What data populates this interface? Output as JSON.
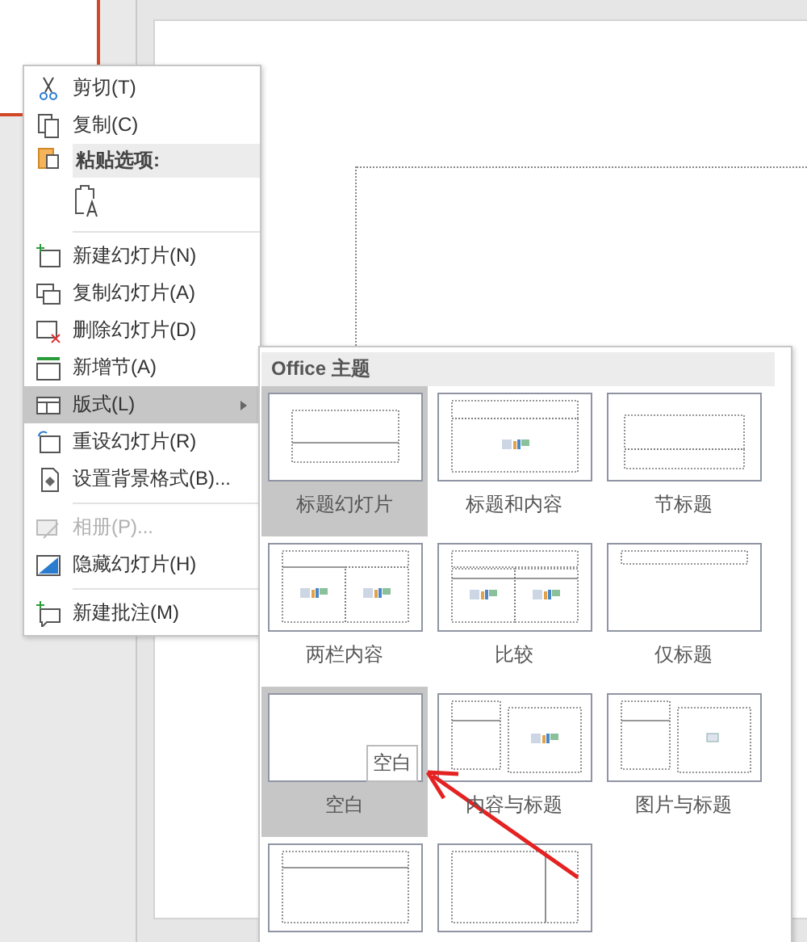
{
  "context_menu": {
    "items": [
      {
        "kind": "command",
        "label": "剪切(T)",
        "disabled": false
      },
      {
        "kind": "command",
        "label": "复制(C)",
        "disabled": false
      },
      {
        "kind": "header",
        "label": "粘贴选项:"
      },
      {
        "kind": "paste"
      },
      {
        "kind": "separator"
      },
      {
        "kind": "command",
        "label": "新建幻灯片(N)",
        "disabled": false
      },
      {
        "kind": "command",
        "label": "复制幻灯片(A)",
        "disabled": false
      },
      {
        "kind": "command",
        "label": "删除幻灯片(D)",
        "disabled": false
      },
      {
        "kind": "command",
        "label": "新增节(A)",
        "disabled": false
      },
      {
        "kind": "submenu",
        "label": "版式(L)",
        "expanded": true
      },
      {
        "kind": "command",
        "label": "重设幻灯片(R)",
        "disabled": false
      },
      {
        "kind": "command",
        "label": "设置背景格式(B)...",
        "disabled": false
      },
      {
        "kind": "separator"
      },
      {
        "kind": "command",
        "label": "相册(P)...",
        "disabled": true
      },
      {
        "kind": "command",
        "label": "隐藏幻灯片(H)",
        "disabled": false
      },
      {
        "kind": "separator"
      },
      {
        "kind": "command",
        "label": "新建批注(M)",
        "disabled": false
      }
    ]
  },
  "layout_gallery": {
    "header": "Office 主题",
    "layouts": [
      {
        "kind": "title",
        "label": "标题幻灯片",
        "selected": true
      },
      {
        "kind": "title-content",
        "label": "标题和内容",
        "selected": false
      },
      {
        "kind": "section",
        "label": "节标题",
        "selected": false
      },
      {
        "kind": "two-content",
        "label": "两栏内容",
        "selected": false
      },
      {
        "kind": "comparison",
        "label": "比较",
        "selected": false
      },
      {
        "kind": "title-only",
        "label": "仅标题",
        "selected": false
      },
      {
        "kind": "blank",
        "label": "空白",
        "selected": true,
        "tooltip": "空白"
      },
      {
        "kind": "content-caption",
        "label": "内容与标题",
        "selected": false
      },
      {
        "kind": "picture-caption",
        "label": "图片与标题",
        "selected": false
      },
      {
        "kind": "title-vertical",
        "selected": false
      },
      {
        "kind": "vertical-title",
        "selected": false
      }
    ]
  }
}
